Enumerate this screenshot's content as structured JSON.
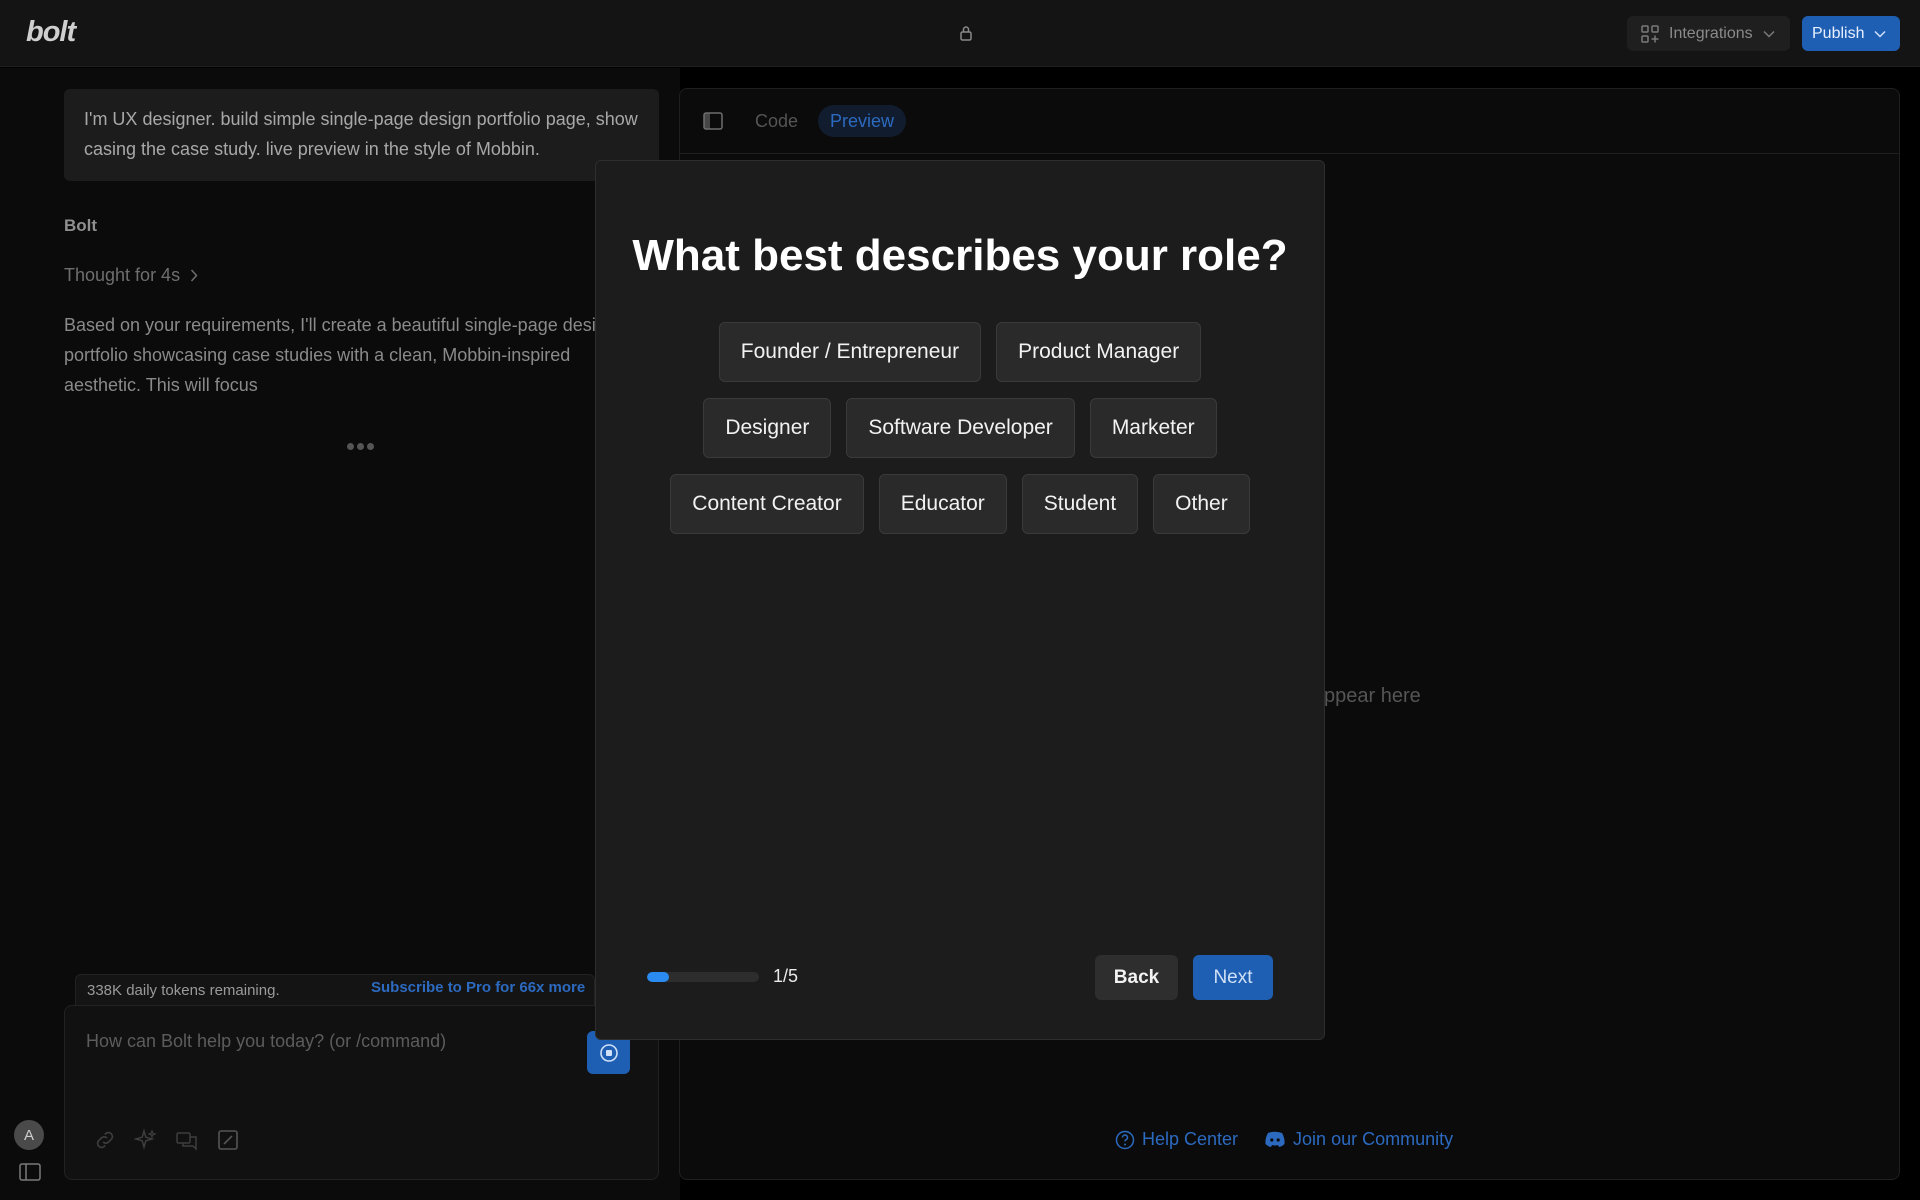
{
  "header": {
    "logo": "bolt",
    "integrations_label": "Integrations",
    "publish_label": "Publish",
    "icons": [
      "lock-icon",
      "grid-icon",
      "chevron-down-icon"
    ]
  },
  "chat": {
    "user_message": "I'm UX designer. build simple single-page design portfolio page, show casing the case study. live preview in the style of Mobbin.",
    "assistant_name": "Bolt",
    "thought_label": "Thought for 4s",
    "assistant_lines": [
      "Based on your requirements, I'll create a beautiful single-page design",
      "portfolio showcasing case studies with a clean, Mobbin-inspired",
      "aesthetic. This will focus"
    ],
    "tokens_text": "338K daily tokens remaining.",
    "subscribe_text": "Subscribe to Pro for 66x more",
    "input_placeholder": "How can Bolt help you today? (or /command)",
    "avatar_letter": "A"
  },
  "preview": {
    "tabs": [
      "Code",
      "Preview"
    ],
    "active_tab": "Preview",
    "placeholder_text": "ppear here",
    "footer_links": [
      "Help Center",
      "Join our Community"
    ]
  },
  "modal": {
    "title": "What best describes your role?",
    "role_rows": [
      [
        "Founder / Entrepreneur",
        "Product Manager"
      ],
      [
        "Designer",
        "Software Developer",
        "Marketer"
      ],
      [
        "Content Creator",
        "Educator",
        "Student",
        "Other"
      ]
    ],
    "progress_fraction": 0.2,
    "progress_label": "1/5",
    "back_label": "Back",
    "next_label": "Next"
  },
  "colors": {
    "accent": "#1f5fb3",
    "link": "#2c6ac0",
    "progress": "#2a8af0",
    "modal_bg": "#1c1c1c"
  }
}
